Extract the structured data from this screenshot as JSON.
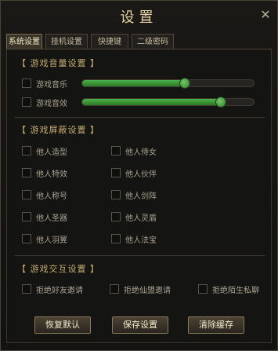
{
  "window": {
    "title": "设置"
  },
  "tabs": [
    {
      "label": "系统设置",
      "active": true
    },
    {
      "label": "挂机设置",
      "active": false
    },
    {
      "label": "快捷键",
      "active": false
    },
    {
      "label": "二级密码",
      "active": false
    }
  ],
  "audio": {
    "title": "【 游戏音量设置 】",
    "music": {
      "label": "游戏音乐",
      "checked": false,
      "level_percent": 60
    },
    "sound": {
      "label": "游戏音效",
      "checked": false,
      "level_percent": 81
    }
  },
  "shield": {
    "title": "【 游戏屏蔽设置 】",
    "items": [
      {
        "label": "他人造型",
        "checked": false
      },
      {
        "label": "他人侍女",
        "checked": false
      },
      {
        "label": "他人特效",
        "checked": false
      },
      {
        "label": "他人伙伴",
        "checked": false
      },
      {
        "label": "他人称号",
        "checked": false
      },
      {
        "label": "他人剑阵",
        "checked": false
      },
      {
        "label": "他人圣器",
        "checked": false
      },
      {
        "label": "他人灵盾",
        "checked": false
      },
      {
        "label": "他人羽翼",
        "checked": false
      },
      {
        "label": "他人法宝",
        "checked": false
      }
    ]
  },
  "interact": {
    "title": "【 游戏交互设置 】",
    "items": [
      {
        "label": "拒绝好友邀请",
        "checked": false
      },
      {
        "label": "拒绝仙盟邀请",
        "checked": false
      },
      {
        "label": "拒绝陌生私聊",
        "checked": false
      }
    ]
  },
  "buttons": {
    "restore": "恢复默认",
    "save": "保存设置",
    "clear": "清除缓存"
  },
  "colors": {
    "accent_gold": "#c6ad71",
    "slider_green": "#4fb04a",
    "title_text": "#e3d4a6"
  }
}
